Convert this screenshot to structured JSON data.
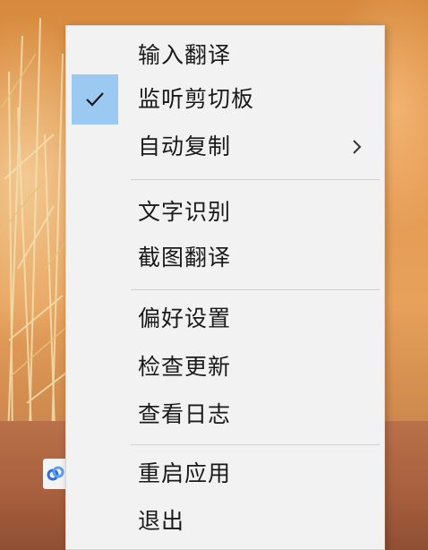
{
  "menu": {
    "items": [
      {
        "label": "输入翻译",
        "checked": false,
        "has_submenu": false
      },
      {
        "label": "监听剪切板",
        "checked": true,
        "has_submenu": false
      },
      {
        "label": "自动复制",
        "checked": false,
        "has_submenu": true
      },
      {
        "label": "文字识别",
        "checked": false,
        "has_submenu": false
      },
      {
        "label": "截图翻译",
        "checked": false,
        "has_submenu": false
      },
      {
        "label": "偏好设置",
        "checked": false,
        "has_submenu": false
      },
      {
        "label": "检查更新",
        "checked": false,
        "has_submenu": false
      },
      {
        "label": "查看日志",
        "checked": false,
        "has_submenu": false
      },
      {
        "label": "重启应用",
        "checked": false,
        "has_submenu": false
      },
      {
        "label": "退出",
        "checked": false,
        "has_submenu": false
      }
    ],
    "check_icon": "checkmark-icon",
    "submenu_icon": "chevron-right-icon",
    "check_highlight_color": "#9cc9f2"
  },
  "taskbar": {
    "app_icon": "link-icon"
  }
}
